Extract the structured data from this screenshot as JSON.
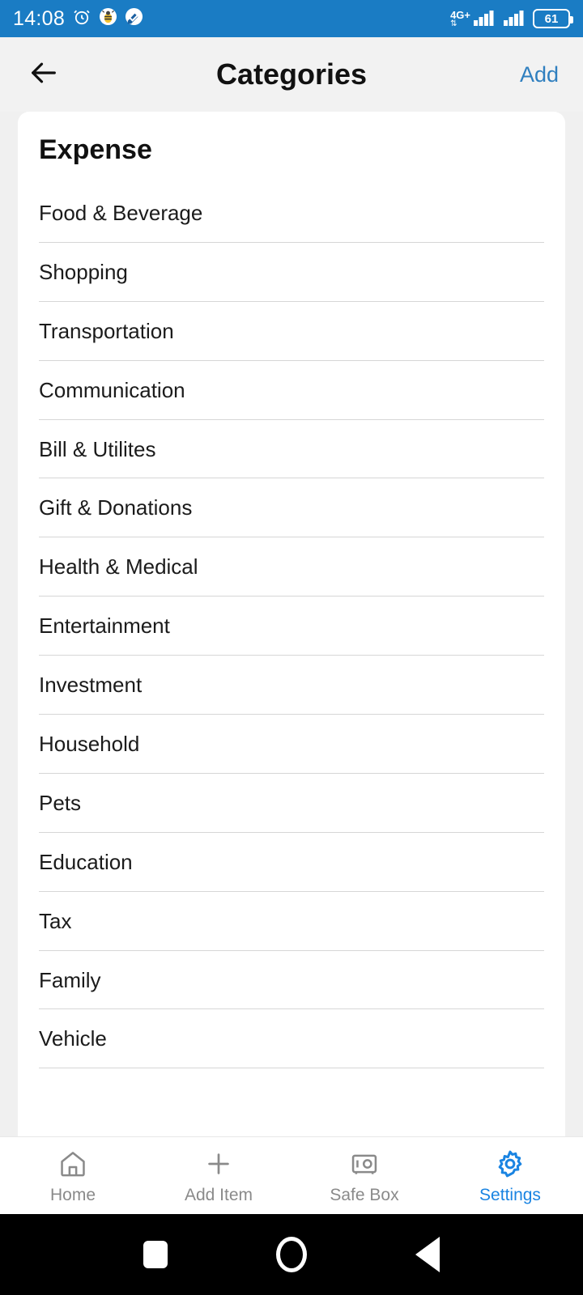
{
  "status_bar": {
    "time": "14:08",
    "alarm_icon": "alarm-clock-icon",
    "notification_icons": [
      "bee-app-icon",
      "check-note-app-icon"
    ],
    "network_type": "4G+",
    "data_arrows": "⇅",
    "signal_icons": [
      "signal-bars-sim1-icon",
      "signal-bars-sim2-icon"
    ],
    "battery_level": "61",
    "bar_color": "#1a7cc4"
  },
  "header": {
    "back_icon": "back-arrow-icon",
    "title": "Categories",
    "add_label": "Add",
    "add_color": "#2f7fbf"
  },
  "content": {
    "section_title": "Expense",
    "categories": [
      "Food & Beverage",
      "Shopping",
      "Transportation",
      "Communication",
      "Bill & Utilites",
      "Gift & Donations",
      "Health & Medical",
      "Entertainment",
      "Investment",
      "Household",
      "Pets",
      "Education",
      "Tax",
      "Family",
      "Vehicle"
    ]
  },
  "tab_bar": {
    "active_color": "#1a84e2",
    "inactive_color": "#8a8a8a",
    "tabs": [
      {
        "label": "Home",
        "icon": "home-icon",
        "active": false
      },
      {
        "label": "Add Item",
        "icon": "plus-icon",
        "active": false
      },
      {
        "label": "Safe Box",
        "icon": "safe-box-icon",
        "active": false
      },
      {
        "label": "Settings",
        "icon": "gear-icon",
        "active": true
      }
    ]
  },
  "android_nav": {
    "recents_icon": "square-recents-icon",
    "home_icon": "circle-home-icon",
    "back_icon": "triangle-back-icon"
  }
}
